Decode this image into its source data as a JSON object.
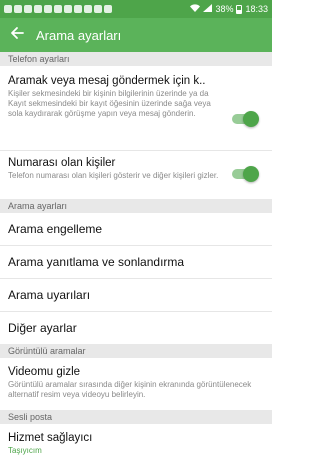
{
  "status_bar": {
    "battery": "38%",
    "time": "18:33"
  },
  "app_bar": {
    "title": "Arama ayarları"
  },
  "sections": {
    "phone_settings": "Telefon ayarları",
    "call_settings": "Arama ayarları",
    "video_calls": "Görüntülü aramalar",
    "voicemail": "Sesli posta"
  },
  "swipe_row": {
    "title": "Aramak veya mesaj göndermek için k..",
    "desc": "Kişiler sekmesindeki bir kişinin bilgilerinin üzerinde ya da Kayıt sekmesindeki bir kayıt öğesinin üzerinde sağa veya sola kaydırarak görüşme yapın veya mesaj gönderin.",
    "enabled": true
  },
  "numbers_row": {
    "title": "Numarası olan kişiler",
    "desc": "Telefon numarası olan kişileri gösterir ve diğer kişileri gizler.",
    "enabled": true
  },
  "call_items": [
    "Arama engelleme",
    "Arama yanıtlama ve sonlandırma",
    "Arama uyarıları",
    "Diğer ayarlar"
  ],
  "hide_video_row": {
    "title": "Videomu gizle",
    "desc": "Görüntülü aramalar sırasında diğer kişinin ekranında görüntülenecek alternatif resim veya videoyu belirleyin."
  },
  "provider_row": {
    "title": "Hizmet sağlayıcı",
    "value": "Taşıyıcım"
  },
  "colors": {
    "accent": "#5bb35a",
    "status": "#4ea54a"
  }
}
